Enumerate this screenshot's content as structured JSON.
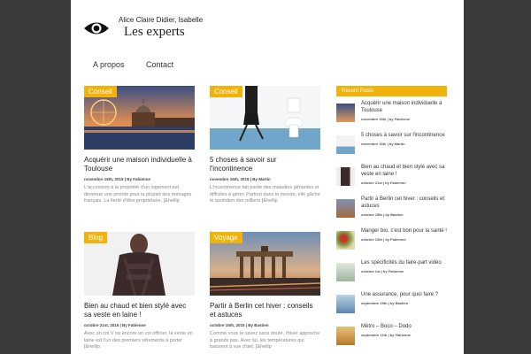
{
  "header": {
    "tagline": "Alice Claire Didier, Isabelle",
    "site_name": "Les experts"
  },
  "nav": {
    "items": [
      "A propos",
      "Contact"
    ]
  },
  "colors": {
    "accent": "#f2b20c",
    "background": "#3b3b3b"
  },
  "posts": [
    {
      "category": "Conseil",
      "title": "Acquérir une maison individuelle à Toulouse",
      "meta": "novembre 16th, 2015 | By Fabienne",
      "excerpt": "L'accession à la propriété d'un logement est devenue une priorité pour la plupart des ménages français. La fierté d'être propriétaire, [&hellip"
    },
    {
      "category": "Conseil",
      "title": "5 choses à savoir sur l'incontinence",
      "meta": "novembre 16th, 2015 | By Martin",
      "excerpt": "L'incontinence fait partie des maladies gênantes et difficiles à gérer. Partout dans le monde, elle gâche le quotidien des milliers [&hellip"
    },
    {
      "category": "Blog",
      "title": "Bien au chaud et bien stylé avec sa veste en laine !",
      "meta": "octobre 21st, 2015 | By Fabienne",
      "excerpt": "Avec un col V ou encore un col officier, la veste en laine est l'un des premiers vêtements à porter [&hellip"
    },
    {
      "category": "Voyage",
      "title": "Partir à Berlin cet hiver : conseils et astuces",
      "meta": "octobre 15th, 2015 | By Bastien",
      "excerpt": "Comme vous le savez sans doute, l'hiver approche à grands pas. Avec lui, les températures qui baissent à vue d'œil, [&hellip"
    }
  ],
  "sidebar": {
    "heading": "Recent Posts",
    "items": [
      {
        "title": "Acquérir une maison individuelle à Toulouse",
        "meta": "novembre 16th | by Fabienne"
      },
      {
        "title": "5 choses à savoir sur l'incontinence",
        "meta": "novembre 16th | by Martin"
      },
      {
        "title": "Bien au chaud et bien stylé avec sa veste en laine !",
        "meta": "octobre 21st | by Fabienne"
      },
      {
        "title": "Partir à Berlin cet hiver : conseils et astuces",
        "meta": "octobre 15th | by Bastien"
      },
      {
        "title": "Manger bio, c'est bon pour la santé !",
        "meta": "octobre 13th | by Fabienne"
      },
      {
        "title": "Les spécificités du faire-part vidéo",
        "meta": "octobre 1st | by Fabienne"
      },
      {
        "title": "Une assurance, pour quoi faire ?",
        "meta": "septembre 29th | by Bastien"
      },
      {
        "title": "Métro – Boco – Dodo",
        "meta": "septembre 11th | by Fabienne"
      }
    ]
  }
}
